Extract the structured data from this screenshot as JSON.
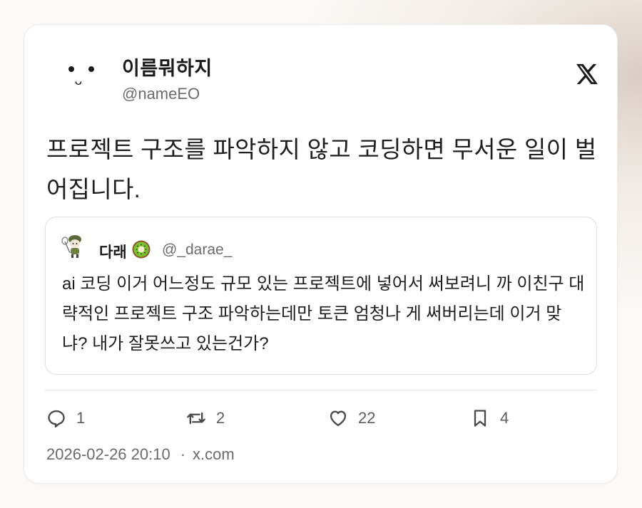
{
  "tweet": {
    "author": {
      "display_name": "이름뭐하지",
      "handle": "@nameEO"
    },
    "platform_icon": "x-logo-icon",
    "text": "프로젝트 구조를 파악하지 않고 코딩하면 무서운 일이 벌어집니다.",
    "quote": {
      "author_name": "다래",
      "author_emoji_icon": "kiwi-icon",
      "author_handle": "@_darae_",
      "text": "ai 코딩 이거 어느정도 규모 있는 프로젝트에 넣어서 써보려니 까 이친구 대략적인 프로젝트 구조 파악하는데만 토큰 엄청나 게 써버리는데 이거 맞냐? 내가 잘못쓰고 있는건가?"
    },
    "stats": {
      "replies": "1",
      "reposts": "2",
      "likes": "22",
      "bookmarks": "4"
    },
    "timestamp": "2026-02-26 20:10",
    "separator": "·",
    "source": "x.com"
  }
}
